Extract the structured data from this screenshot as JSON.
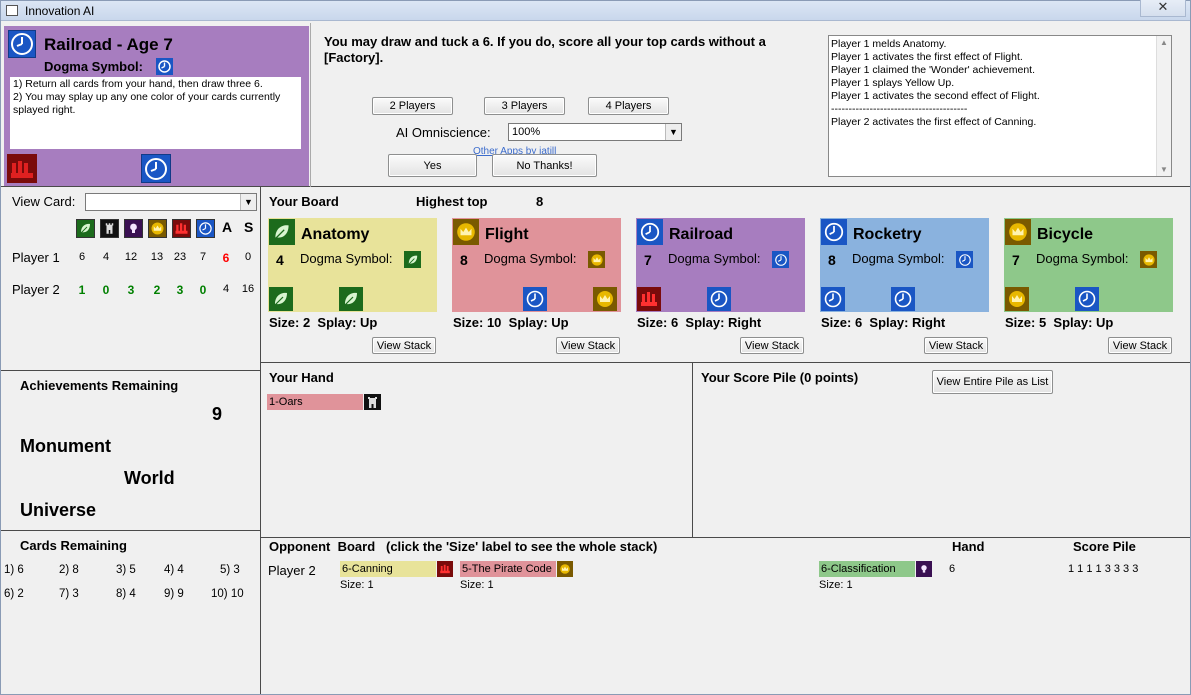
{
  "window": {
    "title": "Innovation AI",
    "close": "✕"
  },
  "colors": {
    "purple": "#a77dbf",
    "red": "#e0939a",
    "yellow": "#e8e39a",
    "blue": "#8ab2de",
    "green": "#8ec88a",
    "green_score": "#008000",
    "red_score": "#ff0000"
  },
  "selected_card": {
    "name": "Railroad - Age 7",
    "dogma_label": "Dogma Symbol:",
    "dogma_icon": "clock-icon",
    "text": "1) Return all cards from your hand, then draw three 6.\n2) You may splay up any one color of your cards currently splayed right."
  },
  "prompt": {
    "text": "You may draw and tuck a 6. If you do, score all your top cards without a [Factory].",
    "yes": "Yes",
    "no": "No Thanks!",
    "ai_label": "AI Omniscience:",
    "ai_value": "100%",
    "other_apps": "Other Apps by jatill",
    "players": [
      "2 Players",
      "3 Players",
      "4 Players"
    ]
  },
  "log": [
    "Player 1 melds Anatomy.",
    "Player 1 activates the first effect of Flight.",
    "Player 1 claimed the 'Wonder' achievement.",
    "Player 1 splays Yellow Up.",
    "Player 1 activates the second effect of Flight.",
    "-----------------------------------------",
    "Player 2 activates the first effect of Canning."
  ],
  "view_card": {
    "label": "View Card:",
    "value": ""
  },
  "score_table": {
    "icon_headers": [
      "leaf-icon",
      "tower-icon",
      "lightbulb-icon",
      "crown-icon",
      "factory-icon",
      "clock-icon"
    ],
    "text_headers": [
      "A",
      "S"
    ],
    "rows": [
      {
        "name": "Player 1",
        "values": [
          "6",
          "4",
          "12",
          "13",
          "23",
          "7",
          "6",
          "0"
        ]
      },
      {
        "name": "Player 2",
        "values": [
          "1",
          "0",
          "3",
          "2",
          "3",
          "0",
          "4",
          "16"
        ]
      }
    ]
  },
  "achievements": {
    "title": "Achievements Remaining",
    "count": "9",
    "items": [
      "Monument",
      "World",
      "Universe"
    ]
  },
  "cards_remaining": {
    "title": "Cards Remaining",
    "items": [
      "1) 6",
      "2) 8",
      "3) 5",
      "4) 4",
      "5) 3",
      "6) 2",
      "7) 3",
      "8) 4",
      "9) 9",
      "10) 10"
    ]
  },
  "board": {
    "title": "Your Board",
    "highest_label": "Highest top",
    "highest_value": "8",
    "view_stack": "View Stack",
    "cards": [
      {
        "name": "Anatomy",
        "age": "4",
        "dogma": "Dogma Symbol:",
        "color": "yellow",
        "size": "Size: 2",
        "splay": "Splay: Up",
        "top_icon": "leaf-icon",
        "icons": [
          "leaf-icon",
          "leaf-icon"
        ]
      },
      {
        "name": "Flight",
        "age": "8",
        "dogma": "Dogma Symbol:",
        "color": "red",
        "size": "Size: 10",
        "splay": "Splay: Up",
        "top_icon": "crown-icon",
        "icons": [
          "clock-icon",
          "crown-icon"
        ]
      },
      {
        "name": "Railroad",
        "age": "7",
        "dogma": "Dogma Symbol:",
        "color": "purple",
        "size": "Size: 6",
        "splay": "Splay: Right",
        "top_icon": "clock-icon",
        "icons": [
          "factory-icon",
          "clock-icon"
        ]
      },
      {
        "name": "Rocketry",
        "age": "8",
        "dogma": "Dogma Symbol:",
        "color": "blue",
        "size": "Size: 6",
        "splay": "Splay: Right",
        "top_icon": "clock-icon",
        "icons": [
          "clock-icon",
          "clock-icon"
        ]
      },
      {
        "name": "Bicycle",
        "age": "7",
        "dogma": "Dogma Symbol:",
        "color": "green",
        "size": "Size: 5",
        "splay": "Splay: Up",
        "top_icon": "crown-icon",
        "icons": [
          "crown-icon",
          "clock-icon"
        ]
      }
    ]
  },
  "hand": {
    "title": "Your Hand",
    "cards": [
      {
        "label": "1-Oars",
        "color": "red",
        "icon": "tower-icon"
      }
    ]
  },
  "score_pile": {
    "title": "Your Score Pile (0 points)",
    "view_button": "View Entire Pile as List"
  },
  "opponent": {
    "title": "Opponent  Board   (click the 'Size' label to see the whole stack)",
    "hand_label": "Hand",
    "score_label": "Score Pile",
    "player": "Player 2",
    "cards": [
      {
        "label": "6-Canning",
        "size": "Size: 1",
        "color": "yellow",
        "icon": "factory-icon"
      },
      {
        "label": "5-The Pirate Code",
        "size": "Size: 1",
        "color": "red",
        "icon": "crown-icon"
      },
      {
        "label": "6-Classification",
        "size": "Size: 1",
        "color": "green",
        "icon": "lightbulb-icon"
      }
    ],
    "hand_count": "6",
    "score_pile": "1 1 1 1 3 3 3 3"
  }
}
